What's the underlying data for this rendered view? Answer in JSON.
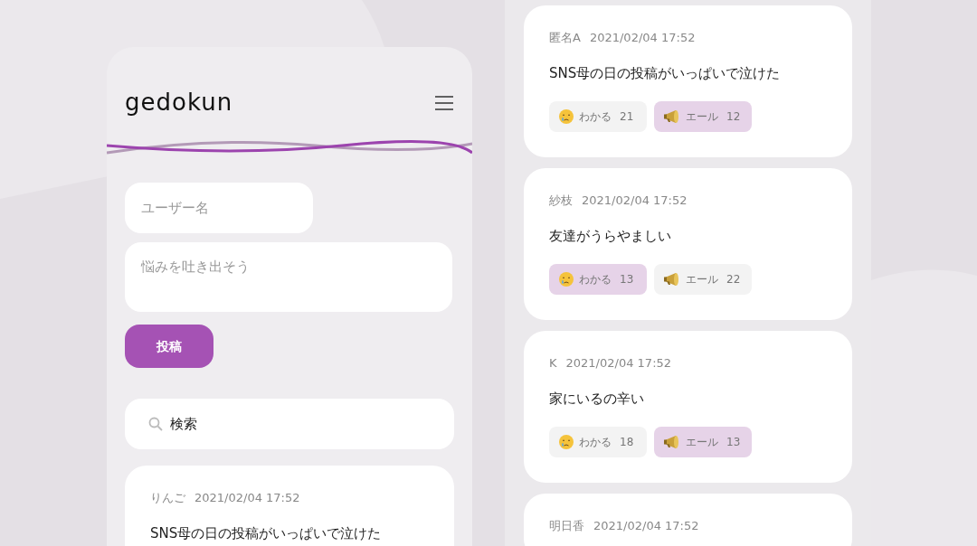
{
  "header": {
    "logo": "gedokun"
  },
  "form": {
    "username_placeholder": "ユーザー名",
    "body_placeholder": "悩みを吐き出そう",
    "submit": "投稿"
  },
  "search": {
    "value": "検索"
  },
  "left_posts": [
    {
      "author": "りんご",
      "time": "2021/02/04 17:52",
      "text": "SNS母の日の投稿がいっぱいで泣けた"
    }
  ],
  "feed_posts": [
    {
      "author": "匿名A",
      "time": "2021/02/04 17:52",
      "text": "SNS母の日の投稿がいっぱいで泣けた",
      "reactions": [
        {
          "kind": "empathy",
          "label": "わかる",
          "count": "21",
          "selected": false
        },
        {
          "kind": "cheer",
          "label": "エール",
          "count": "12",
          "selected": true
        }
      ]
    },
    {
      "author": "紗枝",
      "time": "2021/02/04 17:52",
      "text": "友達がうらやましい",
      "reactions": [
        {
          "kind": "empathy",
          "label": "わかる",
          "count": "13",
          "selected": true
        },
        {
          "kind": "cheer",
          "label": "エール",
          "count": "22",
          "selected": false
        }
      ]
    },
    {
      "author": "K",
      "time": "2021/02/04 17:52",
      "text": "家にいるの辛い",
      "reactions": [
        {
          "kind": "empathy",
          "label": "わかる",
          "count": "18",
          "selected": false
        },
        {
          "kind": "cheer",
          "label": "エール",
          "count": "13",
          "selected": true
        }
      ]
    },
    {
      "author": "明日香",
      "time": "2021/02/04 17:52"
    }
  ]
}
